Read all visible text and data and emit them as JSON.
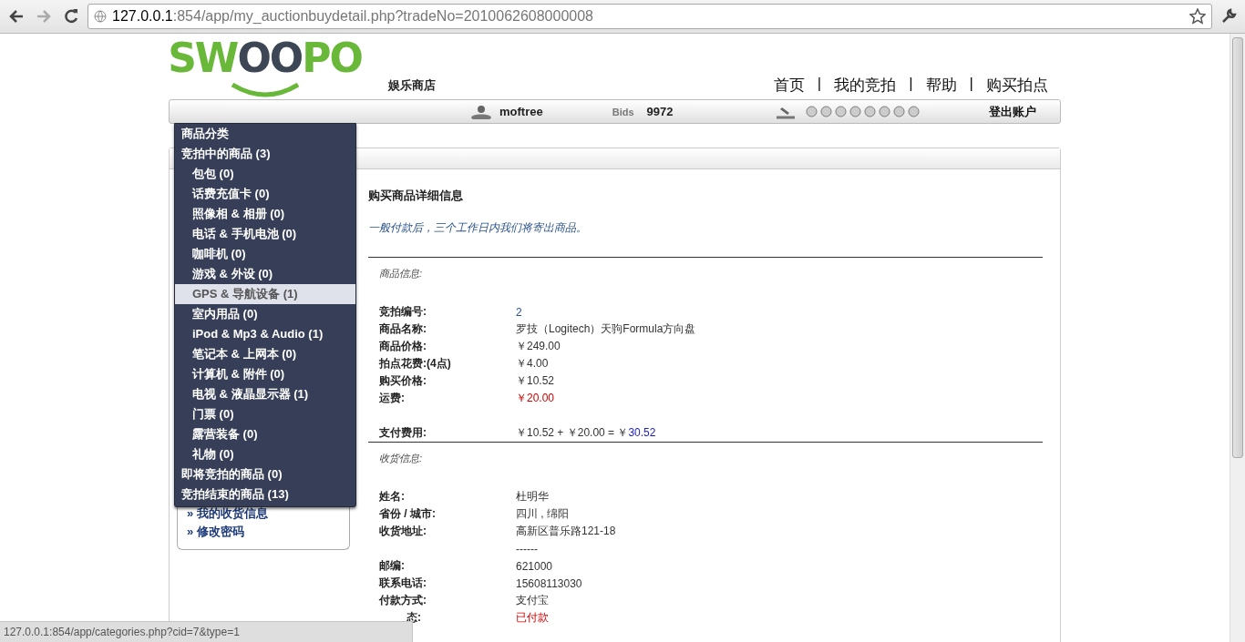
{
  "browser": {
    "url_host": "127.0.0.1",
    "url_rest": ":854/app/my_auctionbuydetail.php?tradeNo=2010062608000008",
    "status_url": "127.0.0.1:854/app/categories.php?cid=7&type=1"
  },
  "header": {
    "logo": "SWOOPO",
    "store_name": "娱乐商店",
    "nav": [
      "首页",
      "我的竞拍",
      "帮助",
      "购买拍点"
    ],
    "separator": "|",
    "user": "moftree",
    "bids_label": "Bids",
    "bids": "9972",
    "logout": "登出账户"
  },
  "menu": {
    "title": "商品分类",
    "items": [
      {
        "label": "竞拍中的商品 (3)",
        "selected": false,
        "children": [
          {
            "label": "包包 (0)",
            "selected": false
          },
          {
            "label": "话费充值卡 (0)",
            "selected": false
          },
          {
            "label": "照像相 & 相册 (0)",
            "selected": false
          },
          {
            "label": "电话 & 手机电池 (0)",
            "selected": false
          },
          {
            "label": "咖啡机 (0)",
            "selected": false
          },
          {
            "label": "游戏 & 外设 (0)",
            "selected": false
          },
          {
            "label": "GPS & 导航设备 (1)",
            "selected": true
          },
          {
            "label": "室内用品 (0)",
            "selected": false
          },
          {
            "label": "iPod & Mp3 & Audio (1)",
            "selected": false
          },
          {
            "label": "笔记本 & 上网本 (0)",
            "selected": false
          },
          {
            "label": "计算机 & 附件 (0)",
            "selected": false
          },
          {
            "label": "电视 & 液晶显示器 (1)",
            "selected": false
          },
          {
            "label": "门票 (0)",
            "selected": false
          },
          {
            "label": "露营装备 (0)",
            "selected": false
          },
          {
            "label": "礼物 (0)",
            "selected": false
          }
        ]
      },
      {
        "label": "即将竞拍的商品 (0)",
        "selected": false
      },
      {
        "label": "竞拍结束的商品 (13)",
        "selected": false
      }
    ]
  },
  "sidebar_links": [
    {
      "marker": "»",
      "label": "我的收货信息"
    },
    {
      "marker": "»",
      "label": "修改密码"
    }
  ],
  "content": {
    "title": "购买商品详细信息",
    "note": "一般付款后，三个工作日内我们将寄出商品。",
    "sections": [
      {
        "heading": "商品信息:",
        "rows": [
          {
            "kind": "link",
            "label": "竞拍编号:",
            "value": "2"
          },
          {
            "kind": "plain",
            "label": "商品名称:",
            "value": "罗技（Logitech）天驹Formula方向盘"
          },
          {
            "kind": "plain",
            "label": "商品价格:",
            "value": "￥249.00"
          },
          {
            "kind": "plain",
            "label": "拍点花费:(4点)",
            "value": "￥4.00"
          },
          {
            "kind": "plain",
            "label": "购买价格:",
            "value": "￥10.52"
          },
          {
            "kind": "alert",
            "label": "运费:",
            "value": "￥20.00"
          },
          {
            "kind": "sum",
            "label": "支付费用:",
            "value": "￥10.52 + ￥20.00 = ￥",
            "result": "30.52"
          }
        ]
      },
      {
        "heading": "收货信息:",
        "rows": [
          {
            "kind": "plain",
            "label": "姓名:",
            "value": "杜明华"
          },
          {
            "kind": "plain",
            "label": "省份 / 城市:",
            "value": "四川 , 绵阳"
          },
          {
            "kind": "plain",
            "label": "收货地址:",
            "value": "高新区普乐路121-18"
          },
          {
            "kind": "more",
            "value": "------"
          },
          {
            "kind": "plain",
            "label": "邮编:",
            "value": "621000"
          },
          {
            "kind": "plain",
            "label": "联系电话:",
            "value": "15608113030"
          },
          {
            "kind": "plain",
            "label": "付款方式:",
            "value": "支付宝"
          },
          {
            "kind": "alert",
            "label": "态:",
            "value": "已付款"
          }
        ]
      }
    ]
  }
}
